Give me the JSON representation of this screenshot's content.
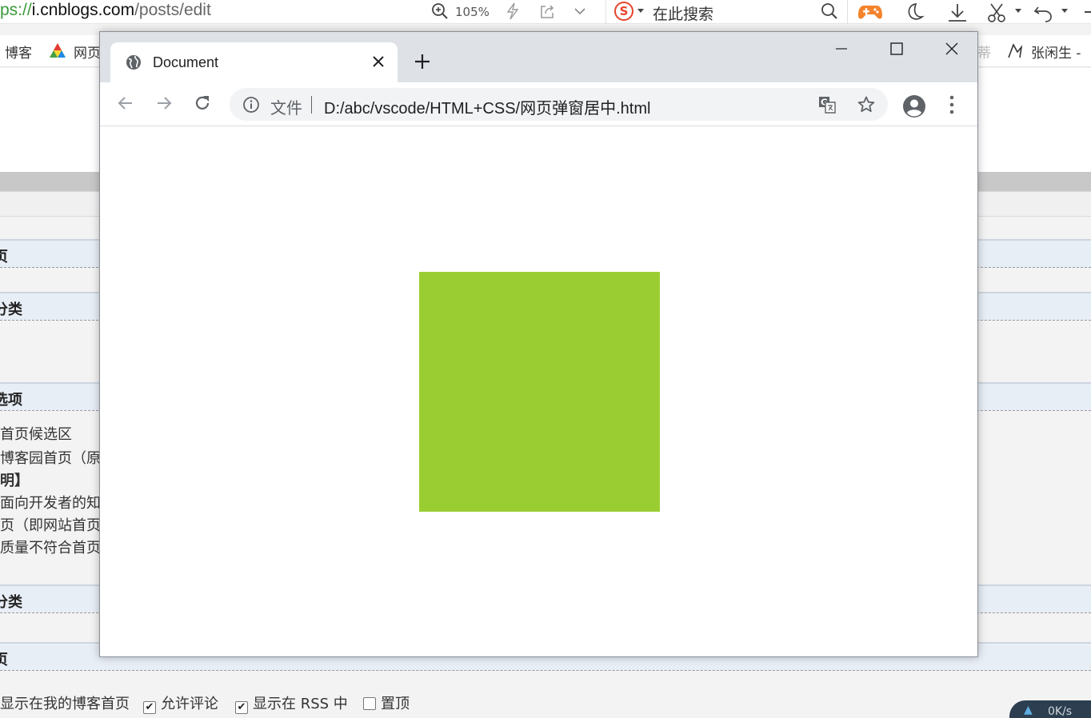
{
  "host": {
    "url": {
      "scheme_fragment": "ps://",
      "domain": "i.cnblogs.com",
      "path": "/posts/edit"
    },
    "zoom": "105%",
    "search_placeholder": "在此搜索",
    "search_logo": "S",
    "bookmarks": {
      "blog": "博客",
      "web": "网页",
      "user": "张闲生 -",
      "faded": "蒂"
    },
    "sections": [
      {
        "label": "页"
      },
      {
        "label": "分类"
      },
      {
        "label": "选项"
      },
      {
        "label": "分类"
      },
      {
        "label": "页"
      }
    ],
    "option_lines": [
      "首页候选区",
      "博客园首页（原",
      "明】",
      "面向开发者的知",
      "页（即网站首页",
      "质量不符合首页"
    ],
    "checkbox_options": [
      {
        "label": "显示在我的博客首页",
        "checked": true
      },
      {
        "label": "允许评论",
        "checked": true
      },
      {
        "label": "显示在 RSS 中",
        "checked": true
      },
      {
        "label": "置顶",
        "checked": false
      }
    ],
    "net_speed": "0K/s"
  },
  "window": {
    "tab": {
      "title": "Document",
      "favicon": "globe-icon",
      "close_icon": "close-icon"
    },
    "new_tab_icon": "plus-icon",
    "controls": [
      "minimize-icon",
      "maximize-icon",
      "close-icon"
    ],
    "nav": [
      "back-arrow-icon",
      "forward-arrow-icon",
      "reload-icon"
    ],
    "omnibox": {
      "security_label": "文件",
      "url": "D:/abc/vscode/HTML+CSS/网页弹窗居中.html"
    },
    "toolbar_icons": [
      "translate-icon",
      "bookmark-star-icon",
      "account-icon",
      "more-menu-icon"
    ]
  },
  "content": {
    "box_color": "#9acd32"
  },
  "colors": {
    "chrome_frame": "#dee1e6",
    "omnibox_bg": "#f1f3f4",
    "host_section_bg": "#e8eef6"
  }
}
